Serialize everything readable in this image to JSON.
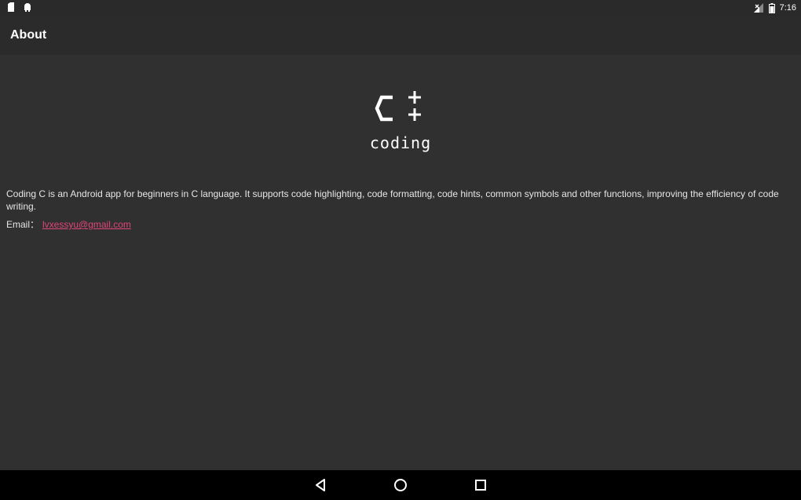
{
  "status_bar": {
    "time": "7:16",
    "left_icons": [
      "notification-icon",
      "android-icon"
    ],
    "right_icons": [
      "signal-icon",
      "battery-icon"
    ]
  },
  "app_bar": {
    "title": "About"
  },
  "logo": {
    "mark": "C++",
    "caption": "coding"
  },
  "about": {
    "description": "Coding C is an Android app for beginners in C language. It supports code highlighting, code formatting, code hints, common symbols and other functions, improving the efficiency of code writing.",
    "email_label": "Email：",
    "email": "lvxessyu@gmail.com"
  },
  "nav_bar": {
    "buttons": [
      "back-icon",
      "home-icon",
      "recents-icon"
    ]
  },
  "colors": {
    "background": "#303030",
    "app_bar": "#2b2b2b",
    "link": "#e0457b",
    "nav_bar": "#000000"
  }
}
